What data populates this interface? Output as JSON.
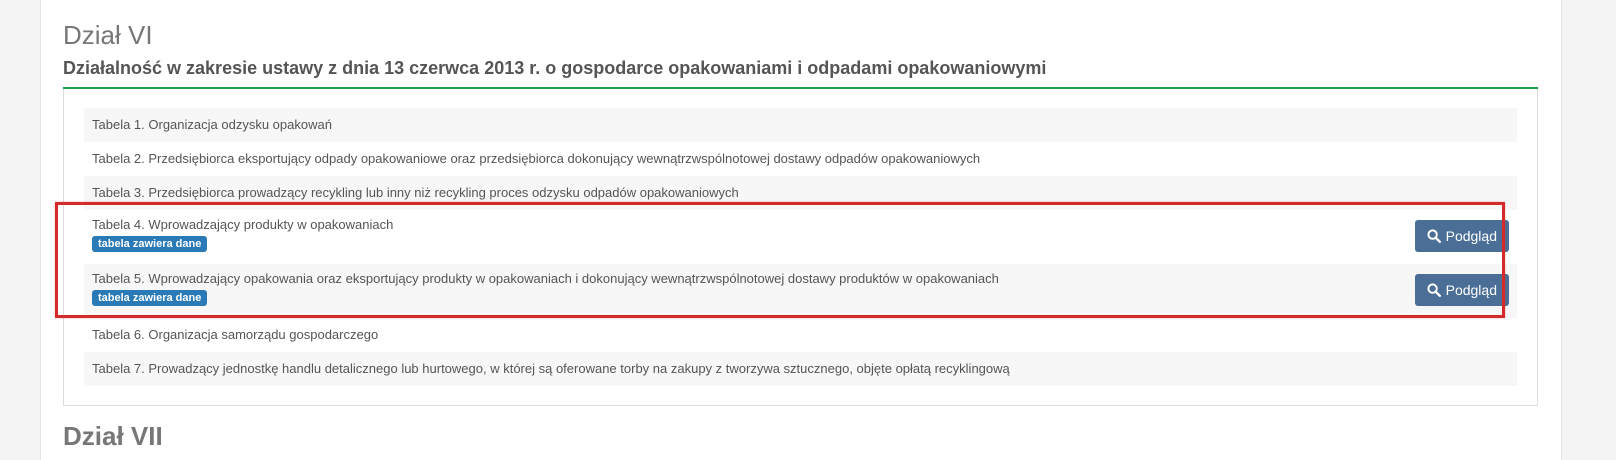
{
  "section": {
    "title": "Dział VI",
    "subtitle": "Działalność w zakresie ustawy z dnia 13 czerwca 2013 r. o gospodarce opakowaniami i odpadami opakowaniowymi"
  },
  "tables": [
    {
      "label": "Tabela 1. Organizacja odzysku opakowań"
    },
    {
      "label": "Tabela 2. Przedsiębiorca eksportujący odpady opakowaniowe oraz przedsiębiorca dokonujący wewnątrzwspólnotowej dostawy odpadów opakowaniowych"
    },
    {
      "label": "Tabela 3. Przedsiębiorca prowadzący recykling lub inny niż recykling proces odzysku odpadów opakowaniowych"
    },
    {
      "label": "Tabela 4. Wprowadzający produkty w opakowaniach",
      "badge": "tabela zawiera dane",
      "button": "Podgląd"
    },
    {
      "label": "Tabela 5. Wprowadzający opakowania oraz eksportujący produkty w opakowaniach i dokonujący wewnątrzwspólnotowej dostawy produktów w opakowaniach",
      "badge": "tabela zawiera dane",
      "button": "Podgląd"
    },
    {
      "label": "Tabela 6. Organizacja samorządu gospodarczego"
    },
    {
      "label": "Tabela 7. Prowadzący jednostkę handlu detalicznego lub hurtowego, w której są oferowane torby na zakupy z tworzywa sztucznego, objęte opłatą recyklingową"
    }
  ],
  "next_section": {
    "title": "Dział VII"
  },
  "colors": {
    "accent_rule": "#1e9e4a",
    "badge": "#2a7ab8",
    "button": "#4a6e96",
    "highlight": "#d42a2a"
  },
  "icons": {
    "button_icon": "search-icon"
  }
}
